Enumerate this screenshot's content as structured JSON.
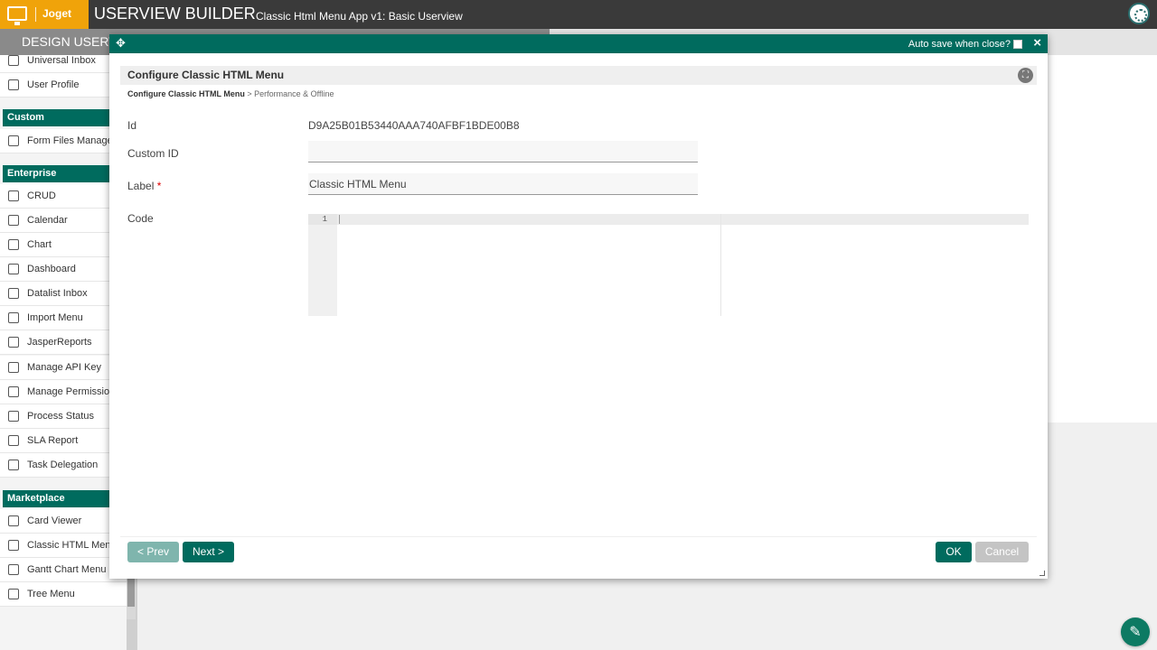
{
  "topbar": {
    "logo_text": "Joget",
    "title": "USERVIEW BUILDER",
    "subtitle": "Classic Html Menu App v1: Basic Userview"
  },
  "design_tab": {
    "label": "DESIGN USERV"
  },
  "palette": {
    "items_top": [
      {
        "label": "Universal Inbox",
        "icon": "inbox-icon"
      },
      {
        "label": "User Profile",
        "icon": "user-edit-icon"
      }
    ],
    "group_custom": "Custom",
    "custom_items": [
      {
        "label": "Form Files Manager",
        "icon": "table-icon"
      }
    ],
    "group_enterprise": "Enterprise",
    "enterprise_items": [
      {
        "label": "CRUD",
        "icon": "crud-icon"
      },
      {
        "label": "Calendar",
        "icon": "calendar-icon"
      },
      {
        "label": "Chart",
        "icon": "chart-icon"
      },
      {
        "label": "Dashboard",
        "icon": "dashboard-icon"
      },
      {
        "label": "Datalist Inbox",
        "icon": "inbox-icon"
      },
      {
        "label": "Import Menu",
        "icon": "import-icon"
      },
      {
        "label": "JasperReports",
        "icon": "report-icon"
      },
      {
        "label": "Manage API Key",
        "icon": "monitor-icon"
      },
      {
        "label": "Manage Permission",
        "icon": "users-icon"
      },
      {
        "label": "Process Status",
        "icon": "process-icon"
      },
      {
        "label": "SLA Report",
        "icon": "sla-icon"
      },
      {
        "label": "Task Delegation",
        "icon": "delegate-icon"
      }
    ],
    "group_marketplace": "Marketplace",
    "marketplace_items": [
      {
        "label": "Card Viewer",
        "icon": "monitor-icon"
      },
      {
        "label": "Classic HTML Menu",
        "icon": "table-icon"
      },
      {
        "label": "Gantt Chart Menu",
        "icon": "table-icon"
      },
      {
        "label": "Tree Menu",
        "icon": "table-icon"
      }
    ]
  },
  "dialog": {
    "autosave_label": "Auto save when close?",
    "title": "Configure Classic HTML Menu",
    "breadcrumb_current": "Configure Classic HTML Menu",
    "breadcrumb_sep": ">",
    "breadcrumb_next": "Performance & Offline",
    "fields": {
      "id_label": "Id",
      "id_value": "D9A25B01B53440AAA740AFBF1BDE00B8",
      "custom_id_label": "Custom ID",
      "custom_id_value": "",
      "label_label": "Label",
      "label_required": "*",
      "label_value": "Classic HTML Menu",
      "code_label": "Code",
      "code_line_number": "1"
    },
    "buttons": {
      "prev": "< Prev",
      "next": "Next >",
      "ok": "OK",
      "cancel": "Cancel"
    }
  }
}
